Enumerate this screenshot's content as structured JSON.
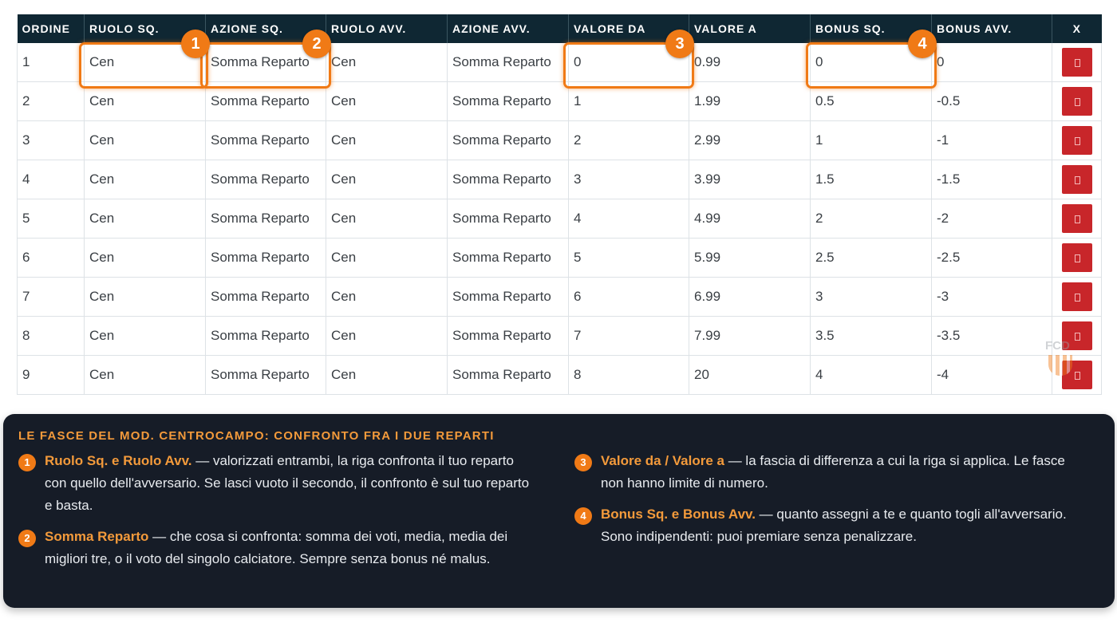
{
  "table": {
    "headers": [
      "ORDINE",
      "RUOLO SQ.",
      "AZIONE SQ.",
      "RUOLO AVV.",
      "AZIONE AVV.",
      "VALORE DA",
      "VALORE A",
      "BONUS SQ.",
      "BONUS AVV.",
      "X"
    ],
    "rows": [
      [
        "1",
        "Cen",
        "Somma Reparto",
        "Cen",
        "Somma Reparto",
        "0",
        "0.99",
        "0",
        "0"
      ],
      [
        "2",
        "Cen",
        "Somma Reparto",
        "Cen",
        "Somma Reparto",
        "1",
        "1.99",
        "0.5",
        "-0.5"
      ],
      [
        "3",
        "Cen",
        "Somma Reparto",
        "Cen",
        "Somma Reparto",
        "2",
        "2.99",
        "1",
        "-1"
      ],
      [
        "4",
        "Cen",
        "Somma Reparto",
        "Cen",
        "Somma Reparto",
        "3",
        "3.99",
        "1.5",
        "-1.5"
      ],
      [
        "5",
        "Cen",
        "Somma Reparto",
        "Cen",
        "Somma Reparto",
        "4",
        "4.99",
        "2",
        "-2"
      ],
      [
        "6",
        "Cen",
        "Somma Reparto",
        "Cen",
        "Somma Reparto",
        "5",
        "5.99",
        "2.5",
        "-2.5"
      ],
      [
        "7",
        "Cen",
        "Somma Reparto",
        "Cen",
        "Somma Reparto",
        "6",
        "6.99",
        "3",
        "-3"
      ],
      [
        "8",
        "Cen",
        "Somma Reparto",
        "Cen",
        "Somma Reparto",
        "7",
        "7.99",
        "3.5",
        "-3.5"
      ],
      [
        "9",
        "Cen",
        "Somma Reparto",
        "Cen",
        "Somma Reparto",
        "8",
        "20",
        "4",
        "-4"
      ]
    ],
    "delete_icon": "trash-icon"
  },
  "markers": [
    "1",
    "2",
    "3",
    "4"
  ],
  "watermark": "FCD",
  "panel": {
    "title": "LE FASCE DEL MOD. CENTROCAMPO: CONFRONTO FRA I DUE REPARTI",
    "notes": [
      {
        "num": "1",
        "key": "Ruolo Sq. e Ruolo Avv.",
        "text": " — valorizzati entrambi, la riga confronta il tuo reparto con quello dell'avversario. Se lasci vuoto il secondo, il confronto è sul tuo reparto e basta."
      },
      {
        "num": "2",
        "key": "Somma Reparto",
        "text": " — che cosa si confronta: somma dei voti, media, media dei migliori tre, o il voto del singolo calciatore. Sempre senza bonus né malus."
      },
      {
        "num": "3",
        "key": "Valore da / Valore a",
        "text": " — la fascia di differenza a cui la riga si applica. Le fasce non hanno limite di numero."
      },
      {
        "num": "4",
        "key": "Bonus Sq. e Bonus Avv.",
        "text": " — quanto assegni a te e quanto togli all'avversario. Sono indipendenti: puoi premiare senza penalizzare."
      }
    ]
  },
  "colors": {
    "accent": "#f07a16",
    "header_bg": "#0f2733",
    "panel_bg": "#161c27",
    "delete": "#c8262a"
  }
}
